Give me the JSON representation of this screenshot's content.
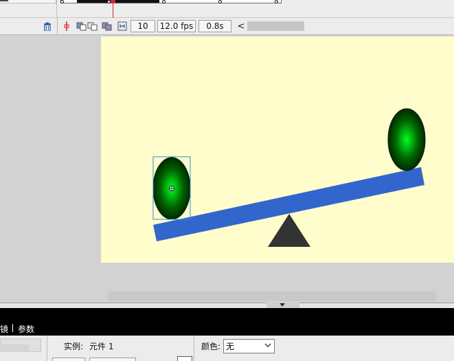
{
  "timeline": {
    "current_frame": "10",
    "frame_rate": "12.0 fps",
    "elapsed_time": "0.8s",
    "scroll_left_symbol": "<",
    "icons": [
      "trash-icon",
      "center-frame-icon",
      "onion-skin-icon",
      "onion-skin-outlines-icon",
      "edit-multiple-frames-icon",
      "modify-onion-markers-icon"
    ]
  },
  "stage": {
    "background_color": "#fffdcc",
    "objects": [
      "left-ball",
      "right-ball",
      "seesaw-plank",
      "fulcrum-triangle"
    ],
    "plank_color": "#3366cc",
    "fulcrum_color": "#333333",
    "ball_colors": [
      "#00ff22",
      "#006600",
      "#001a00"
    ],
    "selection_color": "#2b8fd6"
  },
  "properties": {
    "tab_partial": "镜",
    "tab_params": "参数",
    "instance_label": "实例:",
    "instance_value": "元件 1",
    "color_label": "颜色:",
    "color_value": "无"
  }
}
